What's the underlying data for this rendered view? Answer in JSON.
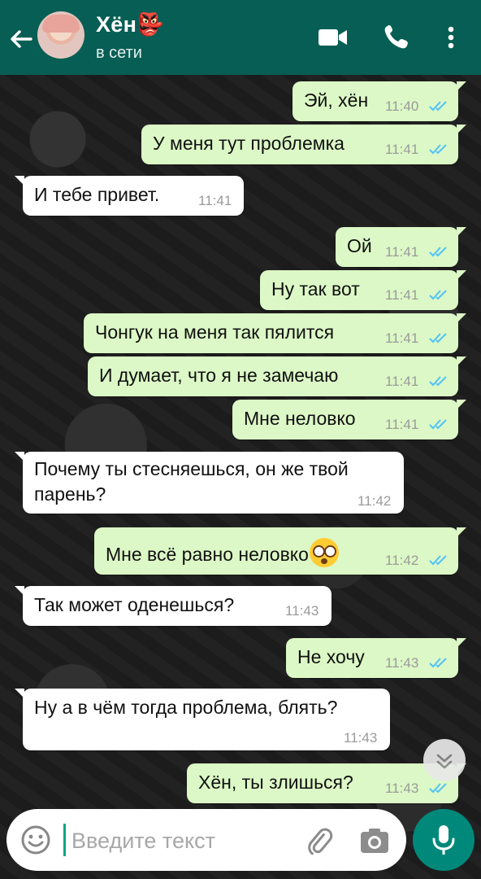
{
  "header": {
    "contact_name": "Хён👺",
    "status": "в сети",
    "avatar_name": "avatar"
  },
  "colors": {
    "header_bg": "#075e54",
    "outgoing_bubble": "#dcf8c6",
    "incoming_bubble": "#ffffff",
    "read_ticks": "#4fc3f7",
    "mic_button": "#00897b"
  },
  "messages": [
    {
      "dir": "out",
      "text": "Эй, хён",
      "time": "11:40",
      "read": true
    },
    {
      "dir": "out",
      "text": "У меня тут проблемка",
      "time": "11:41",
      "read": true
    },
    {
      "dir": "in",
      "text": "И тебе привет.",
      "time": "11:41"
    },
    {
      "dir": "out",
      "text": "Ой",
      "time": "11:41",
      "read": true
    },
    {
      "dir": "out",
      "text": "Ну так вот",
      "time": "11:41",
      "read": true
    },
    {
      "dir": "out",
      "text": "Чонгук на меня так пялится",
      "time": "11:41",
      "read": true
    },
    {
      "dir": "out",
      "text": "И думает, что я не замечаю",
      "time": "11:41",
      "read": true
    },
    {
      "dir": "out",
      "text": "Мне неловко",
      "time": "11:41",
      "read": true
    },
    {
      "dir": "in",
      "text": "Почему ты стесняешься, он же твой парень?",
      "time": "11:42"
    },
    {
      "dir": "out",
      "text": "Мне всё равно неловко",
      "emoji": "flushed-face",
      "time": "11:42",
      "read": true
    },
    {
      "dir": "in",
      "text": "Так может оденешься?",
      "time": "11:43"
    },
    {
      "dir": "out",
      "text": "Не хочу",
      "time": "11:43",
      "read": true
    },
    {
      "dir": "in",
      "text": "Ну а в чём тогда проблема, блять?",
      "time": "11:43"
    },
    {
      "dir": "out",
      "text": "Хён, ты злишься?",
      "time": "11:43",
      "read": true
    }
  ],
  "input": {
    "placeholder": "Введите текст"
  },
  "icons": {
    "back": "arrow-left-icon",
    "video": "video-camera-icon",
    "call": "phone-icon",
    "menu": "more-vertical-icon",
    "emoji": "smiley-icon",
    "attach": "paperclip-icon",
    "camera": "camera-icon",
    "mic": "microphone-icon",
    "scroll": "chevron-double-down-icon"
  }
}
